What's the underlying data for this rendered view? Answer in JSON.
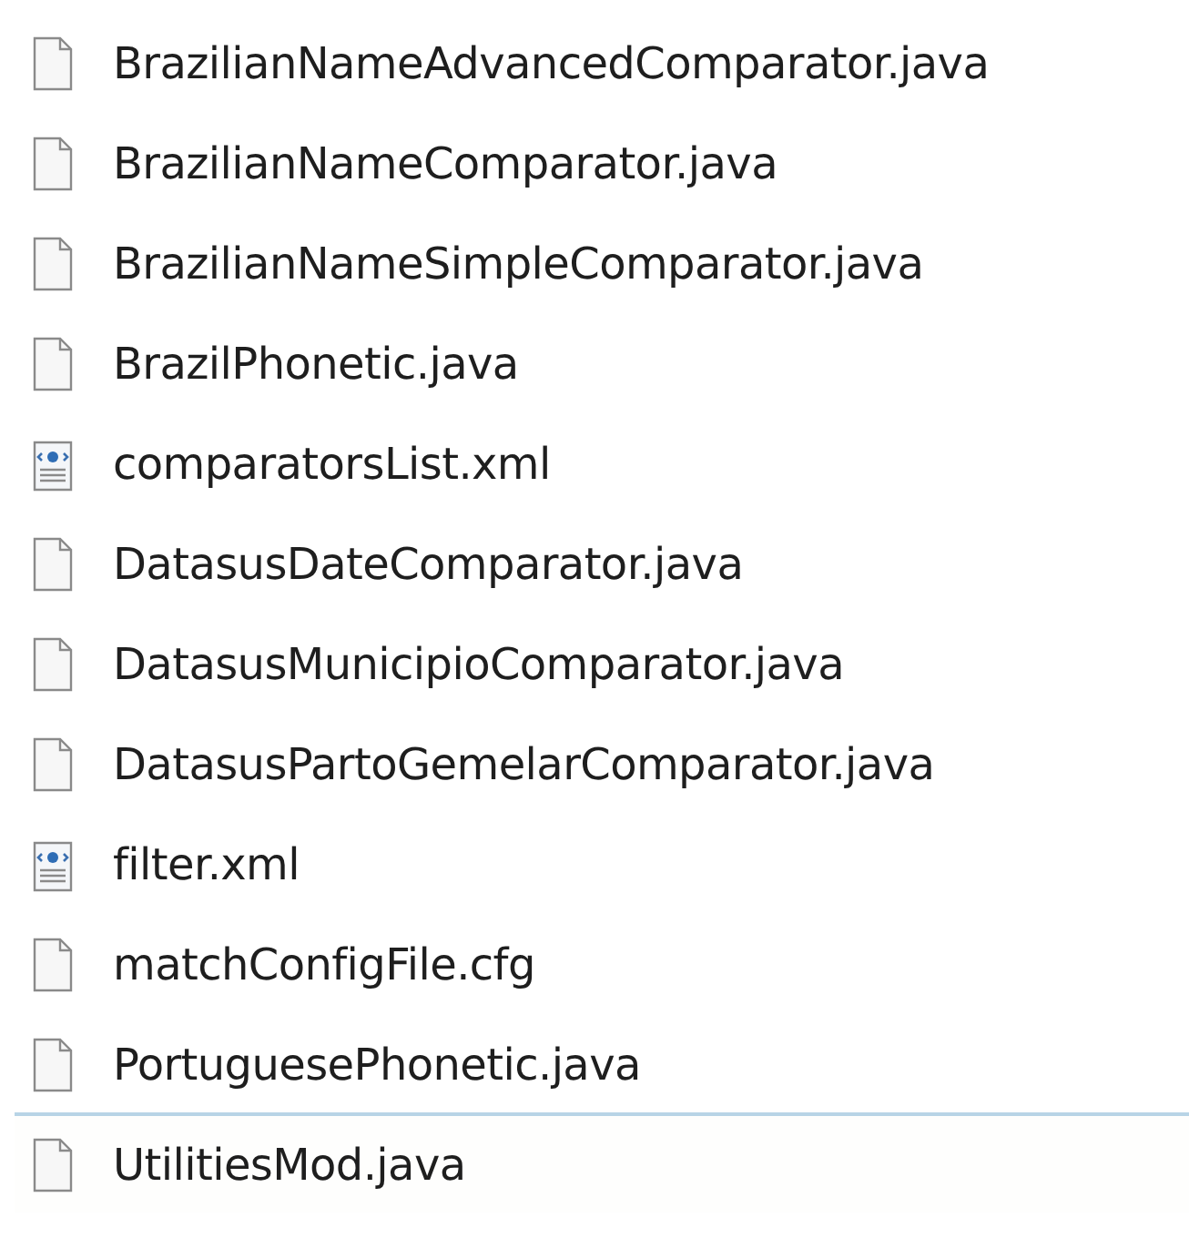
{
  "files": [
    {
      "name": "BrazilianNameAdvancedComparator.java",
      "kind": "file",
      "focused": false
    },
    {
      "name": "BrazilianNameComparator.java",
      "kind": "file",
      "focused": false
    },
    {
      "name": "BrazilianNameSimpleComparator.java",
      "kind": "file",
      "focused": false
    },
    {
      "name": "BrazilPhonetic.java",
      "kind": "file",
      "focused": false
    },
    {
      "name": "comparatorsList.xml",
      "kind": "xml",
      "focused": false
    },
    {
      "name": "DatasusDateComparator.java",
      "kind": "file",
      "focused": false
    },
    {
      "name": "DatasusMunicipioComparator.java",
      "kind": "file",
      "focused": false
    },
    {
      "name": "DatasusPartoGemelarComparator.java",
      "kind": "file",
      "focused": false
    },
    {
      "name": "filter.xml",
      "kind": "xml",
      "focused": false
    },
    {
      "name": "matchConfigFile.cfg",
      "kind": "file",
      "focused": false
    },
    {
      "name": "PortuguesePhonetic.java",
      "kind": "file",
      "focused": false
    },
    {
      "name": "UtilitiesMod.java",
      "kind": "file",
      "focused": true
    }
  ]
}
